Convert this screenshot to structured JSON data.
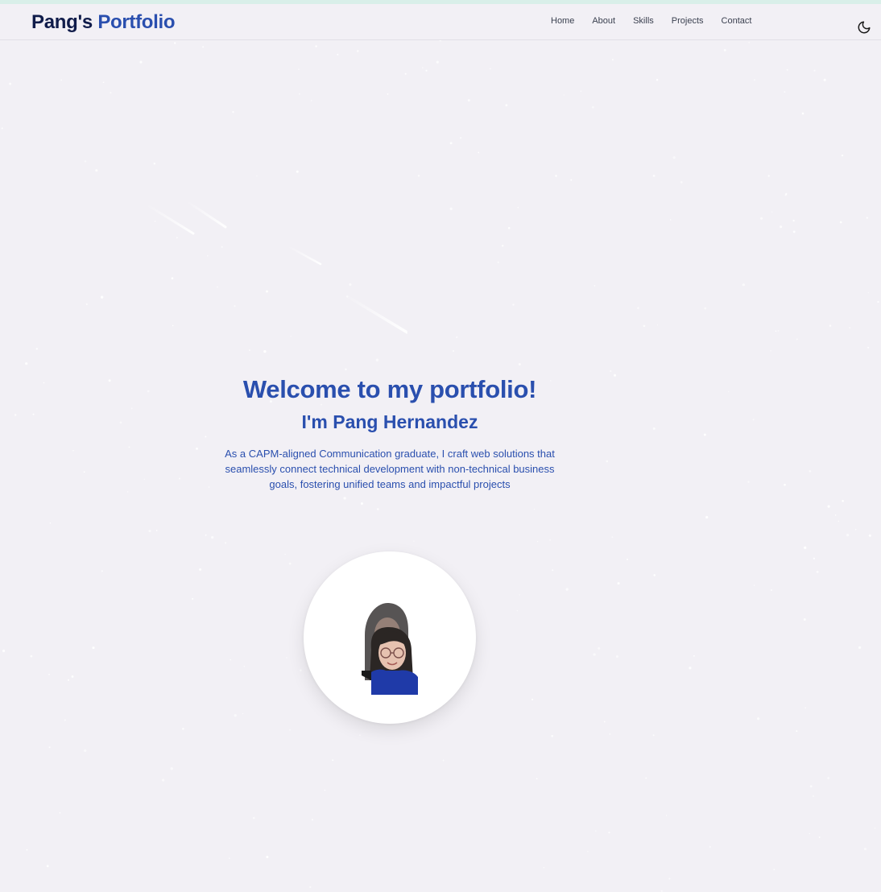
{
  "nav": {
    "brand_name": "Pang's",
    "brand_accent": "Portfolio",
    "links": [
      "Home",
      "About",
      "Skills",
      "Projects",
      "Contact"
    ],
    "theme_icon": "moon-icon"
  },
  "hero": {
    "title": "Welcome to my portfolio!",
    "subtitle": "I'm Pang Hernandez",
    "description": "As a CAPM-aligned Communication graduate, I craft web solutions that seamlessly connect technical development with non-technical business goals, fostering unified teams and impactful projects"
  },
  "colors": {
    "background": "#f2f0f5",
    "accent": "#2a4fae",
    "brand_dark": "#101c4a",
    "nav_text": "#3b4150"
  }
}
